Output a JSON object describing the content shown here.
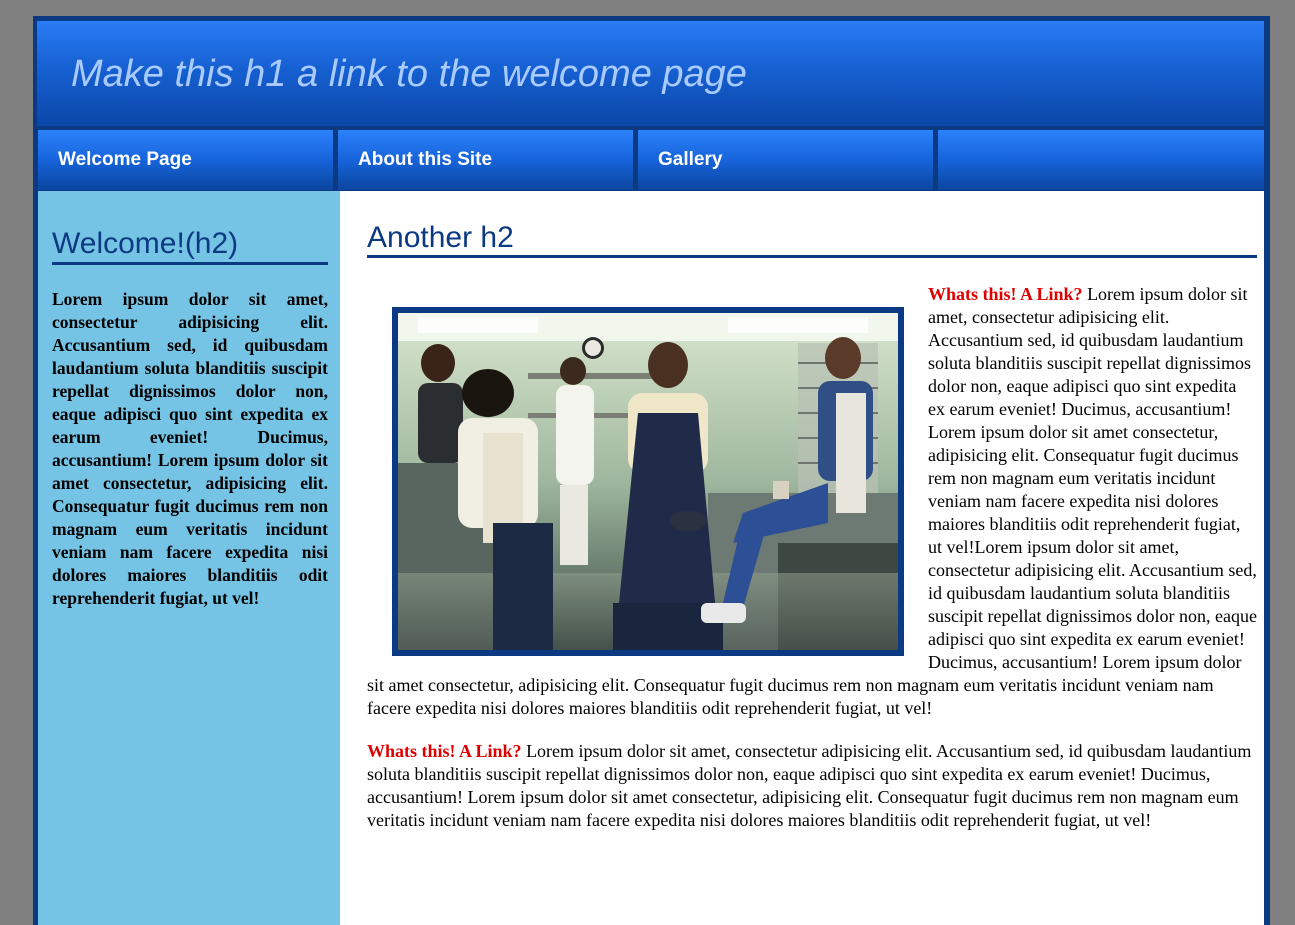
{
  "header": {
    "title": "Make this h1 a link to the welcome page"
  },
  "nav": {
    "items": [
      {
        "label": "Welcome Page"
      },
      {
        "label": "About this Site"
      },
      {
        "label": "Gallery"
      },
      {
        "label": ""
      }
    ]
  },
  "sidebar": {
    "heading": "Welcome!(h2)",
    "text": "Lorem ipsum dolor sit amet, consectetur adipisicing elit. Accusantium sed, id quibusdam laudantium soluta blanditiis suscipit repellat dignissimos dolor non, eaque adipisci quo sint expedita ex earum eveniet! Ducimus, accusantium! Lorem ipsum dolor sit amet consectetur, adipisicing elit. Consequatur fugit ducimus rem non magnam eum veritatis incidunt veniam nam facere expedita nisi dolores maiores blanditiis odit reprehenderit fugiat, ut vel!"
  },
  "main": {
    "heading": "Another h2",
    "paragraph1": {
      "link": "Whats this! A Link?",
      "text": " Lorem ipsum dolor sit amet, consectetur adipisicing elit. Accusantium sed, id quibusdam laudantium soluta blanditiis suscipit repellat dignissimos dolor non, eaque adipisci quo sint expedita ex earum eveniet! Ducimus, accusantium! Lorem ipsum dolor sit amet consectetur, adipisicing elit. Consequatur fugit ducimus rem non magnam eum veritatis incidunt veniam nam facere expedita nisi dolores maiores blanditiis odit reprehenderit fugiat, ut vel!Lorem ipsum dolor sit amet, consectetur adipisicing elit. Accusantium sed, id quibusdam laudantium soluta blanditiis suscipit repellat dignissimos dolor non, eaque adipisci quo sint expedita ex earum eveniet! Ducimus, accusantium! Lorem ipsum dolor sit amet consectetur, adipisicing elit. Consequatur fugit ducimus rem non magnam eum veritatis incidunt veniam nam facere expedita nisi dolores maiores blanditiis odit reprehenderit fugiat, ut vel!"
    },
    "paragraph2": {
      "link": "Whats this! A Link?",
      "text": " Lorem ipsum dolor sit amet, consectetur adipisicing elit. Accusantium sed, id quibusdam laudantium soluta blanditiis suscipit repellat dignissimos dolor non, eaque adipisci quo sint expedita ex earum eveniet! Ducimus, accusantium! Lorem ipsum dolor sit amet consectetur, adipisicing elit. Consequatur fugit ducimus rem non magnam eum veritatis incidunt veniam nam facere expedita nisi dolores maiores blanditiis odit reprehenderit fugiat, ut vel!"
    }
  },
  "colors": {
    "page_background": "#808080",
    "frame": "#0c3a82",
    "header_gradient_top": "#2a7cf5",
    "title_text": "#a9cbff",
    "sidebar_background": "#76c4e5",
    "heading_text": "#0c3a82",
    "link_red": "#e00000"
  }
}
